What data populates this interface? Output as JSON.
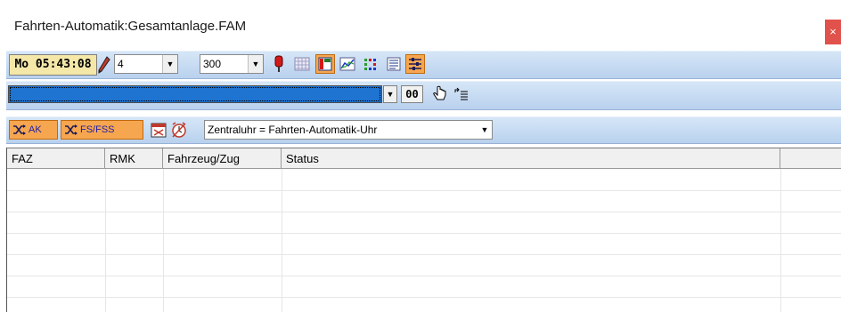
{
  "window": {
    "title": "Fahrten-Automatik:Gesamtanlage.FAM",
    "close_label": "×"
  },
  "toolbar1": {
    "clock_text": "Mo  05:43:08",
    "combo1_value": "4",
    "combo2_value": "300",
    "icons": [
      "pencil-icon",
      "red-signal-icon",
      "grid-view-icon",
      "color-table-icon",
      "chart-icon",
      "dots-matrix-icon",
      "list-view-icon",
      "settings-sliders-icon"
    ]
  },
  "toolbar2": {
    "progress": 1.0,
    "number_box": "00",
    "icons": [
      "hand-pointer-icon",
      "list-step-icon"
    ]
  },
  "toolbar3": {
    "ak_label": "AK",
    "fsfss_label": "FS/FSS",
    "clock_select_value": "Zentraluhr = Fahrten-Automatik-Uhr",
    "icons": [
      "shuffle-icon",
      "shuffle-icon",
      "calendar-icon",
      "alarm-clock-icon"
    ]
  },
  "table": {
    "columns": [
      "FAZ",
      "RMK",
      "Fahrzeug/Zug",
      "Status"
    ],
    "rows": []
  },
  "colors": {
    "toolbar_blue": "#c7dbf2",
    "accent_orange": "#f6a64f",
    "progress_blue": "#1f73d1",
    "clock_yellow": "#f4e7a8"
  }
}
